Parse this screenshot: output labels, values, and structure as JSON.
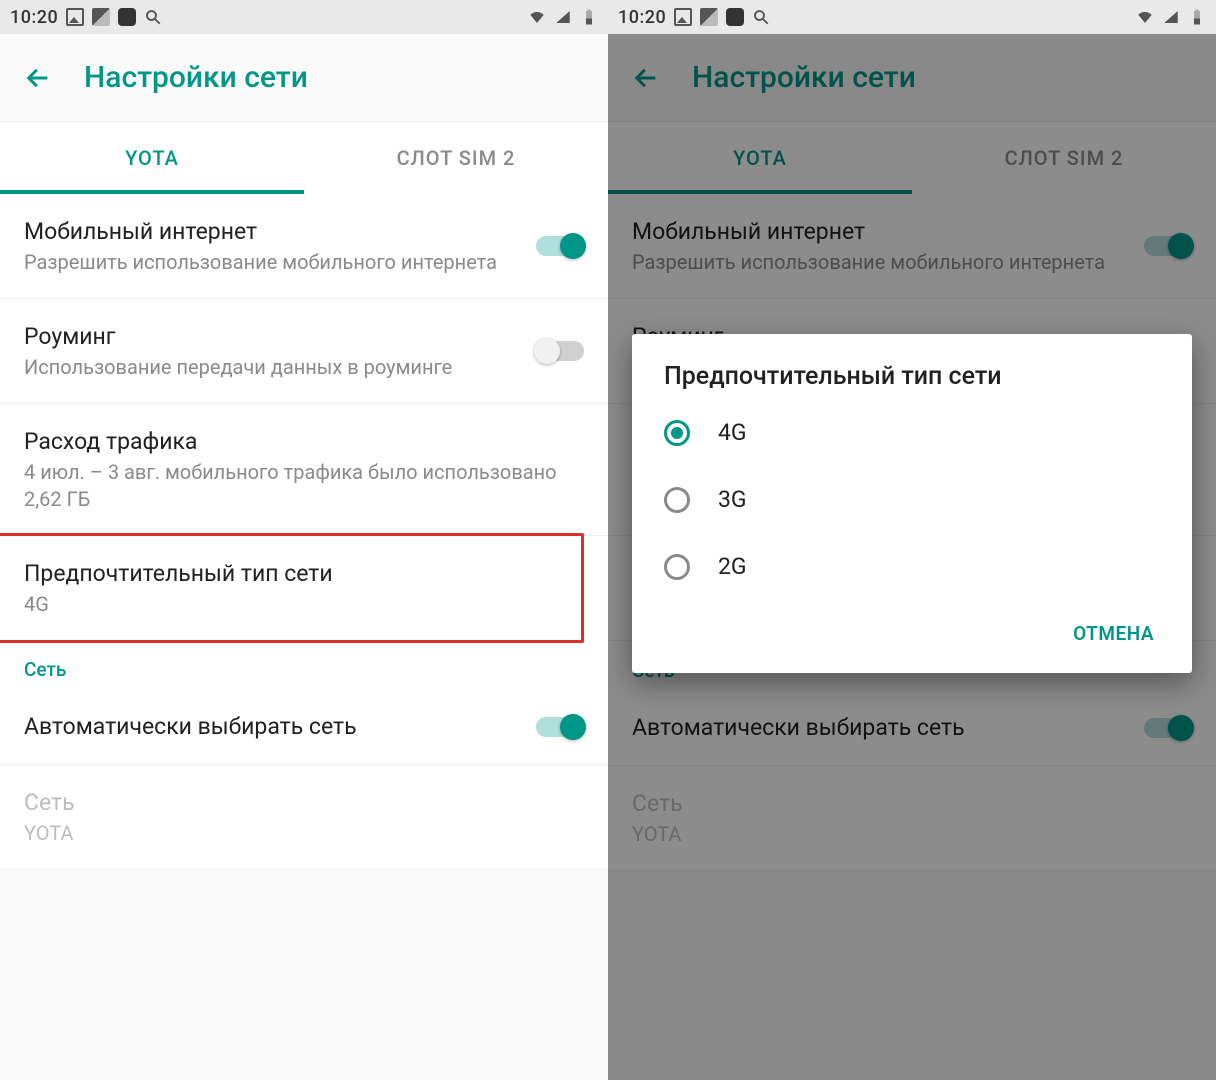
{
  "status": {
    "time": "10:20"
  },
  "appbar": {
    "title": "Настройки сети"
  },
  "tabs": {
    "active": "YOTA",
    "inactive": "СЛОТ SIM 2"
  },
  "rows": {
    "mobile_data": {
      "title": "Мобильный интернет",
      "subtitle": "Разрешить использование мобильного интернета"
    },
    "roaming": {
      "title": "Роуминг",
      "subtitle": "Использование передачи данных в роуминге"
    },
    "usage": {
      "title": "Расход трафика",
      "subtitle": "4 июл. – 3 авг. мобильного трафика было использовано 2,62 ГБ"
    },
    "pref_net": {
      "title": "Предпочтительный тип сети",
      "subtitle": "4G"
    },
    "auto_net": {
      "title": "Автоматически выбирать сеть"
    },
    "network": {
      "title": "Сеть",
      "subtitle": "YOTA"
    }
  },
  "section": {
    "network": "Сеть"
  },
  "dialog": {
    "title": "Предпочтительный тип сети",
    "options": {
      "o1": "4G",
      "o2": "3G",
      "o3": "2G"
    },
    "cancel": "ОТМЕНА"
  }
}
